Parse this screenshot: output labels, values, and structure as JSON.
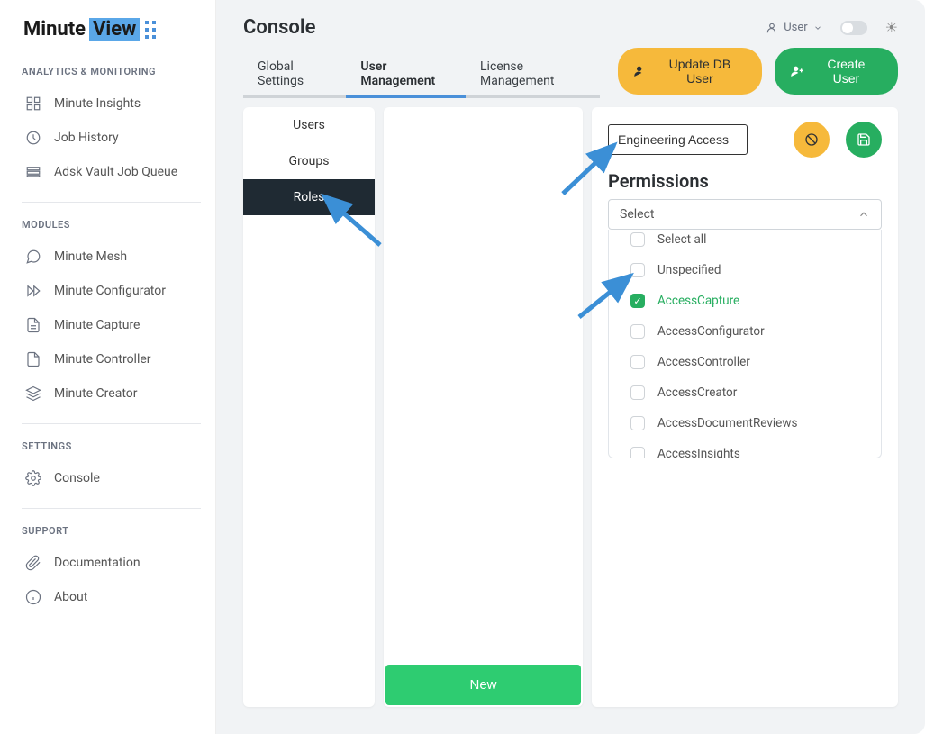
{
  "logo": {
    "part1": "Minute",
    "part2": "View"
  },
  "sidebar": {
    "sections": [
      {
        "label": "ANALYTICS & MONITORING",
        "items": [
          {
            "icon": "grid-icon",
            "label": "Minute Insights"
          },
          {
            "icon": "clock-icon",
            "label": "Job History"
          },
          {
            "icon": "queue-icon",
            "label": "Adsk Vault Job Queue"
          }
        ]
      },
      {
        "label": "MODULES",
        "items": [
          {
            "icon": "chat-icon",
            "label": "Minute Mesh"
          },
          {
            "icon": "forward-icon",
            "label": "Minute Configurator"
          },
          {
            "icon": "page-icon",
            "label": "Minute Capture"
          },
          {
            "icon": "doc-icon",
            "label": "Minute Controller"
          },
          {
            "icon": "layers-icon",
            "label": "Minute Creator"
          }
        ]
      },
      {
        "label": "SETTINGS",
        "items": [
          {
            "icon": "gear-icon",
            "label": "Console"
          }
        ]
      },
      {
        "label": "SUPPORT",
        "items": [
          {
            "icon": "attachment-icon",
            "label": "Documentation"
          },
          {
            "icon": "info-icon",
            "label": "About"
          }
        ]
      }
    ]
  },
  "header": {
    "title": "Console",
    "user_label": "User"
  },
  "tabs": [
    {
      "label": "Global Settings",
      "active": false
    },
    {
      "label": "User Management",
      "active": true
    },
    {
      "label": "License Management",
      "active": false
    }
  ],
  "actions": {
    "update_db_user": "Update DB User",
    "create_user": "Create User"
  },
  "subtabs": [
    {
      "label": "Users",
      "active": false
    },
    {
      "label": "Groups",
      "active": false
    },
    {
      "label": "Roles",
      "active": true
    }
  ],
  "mid_panel": {
    "new_button": "New"
  },
  "role_editor": {
    "name_value": "Engineering Access",
    "permissions_title": "Permissions",
    "select_placeholder": "Select",
    "options": [
      {
        "label": "Select all",
        "checked": false
      },
      {
        "label": "Unspecified",
        "checked": false
      },
      {
        "label": "AccessCapture",
        "checked": true
      },
      {
        "label": "AccessConfigurator",
        "checked": false
      },
      {
        "label": "AccessController",
        "checked": false
      },
      {
        "label": "AccessCreator",
        "checked": false
      },
      {
        "label": "AccessDocumentReviews",
        "checked": false
      },
      {
        "label": "AccessInsights",
        "checked": false
      }
    ]
  }
}
